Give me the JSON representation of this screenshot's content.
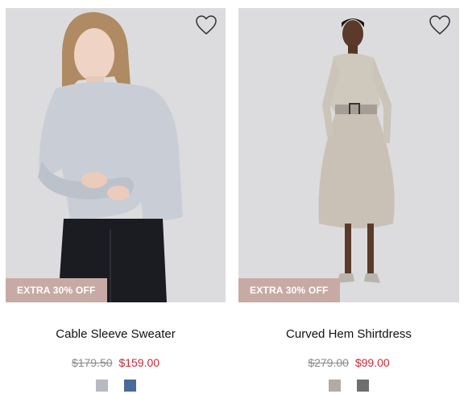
{
  "accent": "#c8293a",
  "badge_color": "#c8aaa4",
  "products": [
    {
      "name": "Cable Sleeve Sweater",
      "badge": "EXTRA 30% OFF",
      "original_price": "$179.50",
      "sale_price": "$159.00",
      "swatches": [
        {
          "color": "#b7b9c3",
          "label": "light grey"
        },
        {
          "color": "#4a6a9b",
          "label": "blue"
        }
      ]
    },
    {
      "name": "Curved Hem Shirtdress",
      "badge": "EXTRA 30% OFF",
      "original_price": "$279.00",
      "sale_price": "$99.00",
      "swatches": [
        {
          "color": "#b3aba1",
          "label": "taupe"
        },
        {
          "color": "#6e6e6e",
          "label": "charcoal"
        }
      ]
    }
  ]
}
